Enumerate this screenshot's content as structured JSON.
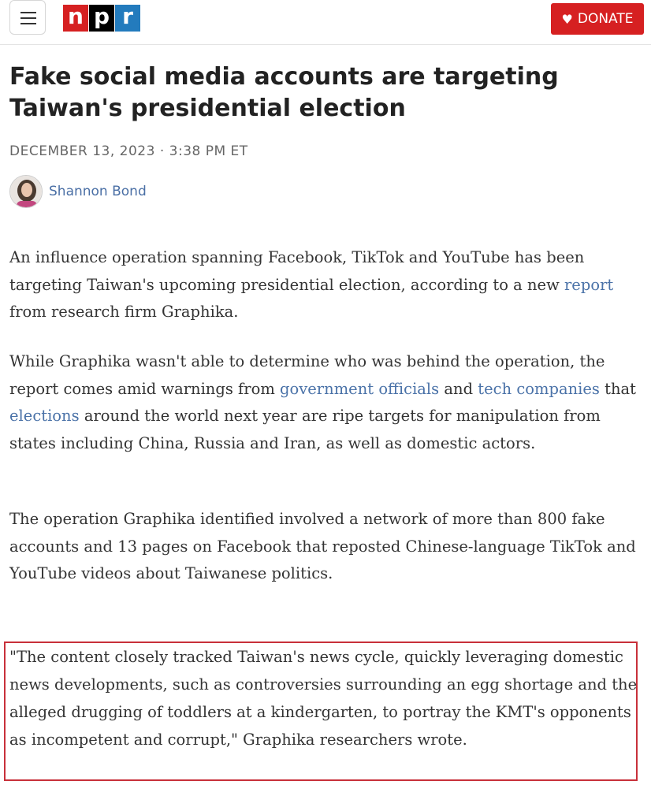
{
  "header": {
    "logo_letters": [
      "n",
      "p",
      "r"
    ],
    "logo_colors": [
      "#d62021",
      "#000000",
      "#237bbd"
    ],
    "donate_label": "DONATE",
    "donate_icon": "heart-icon",
    "menu_icon": "hamburger-menu-icon"
  },
  "article": {
    "title": "Fake social media accounts are targeting Taiwan's presidential election",
    "dateline": "DECEMBER 13, 2023 · 3:38 PM ET",
    "author": "Shannon Bond",
    "p1": {
      "t1": "An influence operation spanning Facebook, TikTok and YouTube has been targeting Taiwan's upcoming presidential election, according to a new ",
      "link1": "report",
      "t2": " from research firm Graphika."
    },
    "p2": {
      "t1": "While Graphika wasn't able to determine who was behind the operation, the report comes amid warnings from ",
      "link1": "government officials",
      "t2": " and ",
      "link2": "tech companies",
      "t3": " that ",
      "link3": "elections",
      "t4": " around the world next year are ripe targets for manipulation from states including China, Russia and Iran, as well as domestic actors."
    },
    "p3": "The operation Graphika identified involved a network of more than 800 fake accounts and 13 pages on Facebook that reposted Chinese-language TikTok and YouTube videos about Taiwanese politics.",
    "quote": "\"The content closely tracked Taiwan's news cycle, quickly leveraging domestic news developments, such as controversies surrounding an egg shortage and the alleged drugging of toddlers at a kindergarten, to portray the KMT's opponents as incompetent and corrupt,\" Graphika researchers wrote."
  },
  "colors": {
    "link": "#4a72a8",
    "highlight_border": "#c8303a",
    "donate_bg": "#d62021"
  }
}
